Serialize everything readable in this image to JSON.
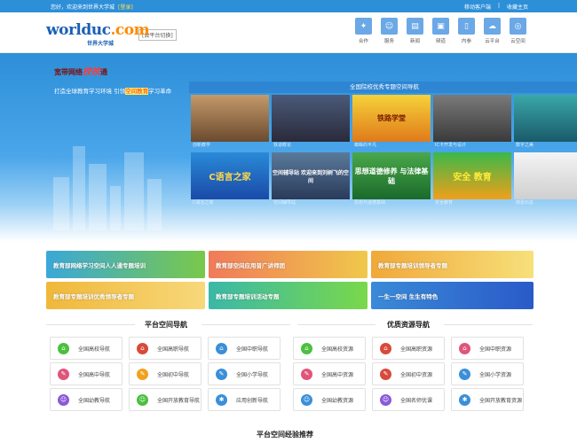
{
  "topbar": {
    "welcome": "您好，欢迎来到世界大学城",
    "login": "[登录]",
    "mobile": "移动客户端",
    "sep": "|",
    "favorite": "收藏主页"
  },
  "header": {
    "logo_text": "worlduc",
    "logo_accent": ".com",
    "logo_cn": "世界大学城",
    "switch_label": "[云平台切换]",
    "nav": [
      {
        "label": "合作",
        "icon": "handshake-icon"
      },
      {
        "label": "服务",
        "icon": "user-icon"
      },
      {
        "label": "新闻",
        "icon": "news-icon"
      },
      {
        "label": "频道",
        "icon": "channel-icon"
      },
      {
        "label": "内参",
        "icon": "document-icon"
      },
      {
        "label": "云平台",
        "icon": "cloud-icon"
      },
      {
        "label": "云空间",
        "icon": "space-icon"
      }
    ]
  },
  "banner": {
    "slogan_a": "宽带网络",
    "slogan_hl": "校校",
    "slogan_b": "通",
    "line_a": "打造全球教育学习环境  引领",
    "line_hl": "空间教育",
    "line_b": "学习革命"
  },
  "showcase": {
    "caption": "全国院校优秀专题空间导航",
    "tiles": [
      {
        "title": "创新教学",
        "text": ""
      },
      {
        "title": "铁道概论",
        "text": ""
      },
      {
        "title": "蜘蛛的平凡",
        "text": "铁路学堂"
      },
      {
        "title": "报刊的制作",
        "text": "一朵花的报刊制作"
      },
      {
        "title": "IC卡开发与设计",
        "text": ""
      },
      {
        "title": "数字之美",
        "text": ""
      },
      {
        "title": "C语言之家",
        "text": "C语言之家"
      },
      {
        "title": "空间辅导站",
        "text": "空间辅导站 欢迎来到刘树飞的空间"
      },
      {
        "title": "思想与道德基础",
        "text": "思想道德修养 与法律基础"
      },
      {
        "title": "安全教育",
        "text": "安全 教育"
      },
      {
        "title": "微景石友",
        "text": ""
      }
    ]
  },
  "promos": [
    {
      "label": "教育部网络学习空间人人通专题培训"
    },
    {
      "label": "教育部空间应用普广讲师团"
    },
    {
      "label": "教育部专题培训领导者专题"
    },
    {
      "label": "教育部专题培训优秀领导者专题"
    },
    {
      "label": "教育部专题培训活动专题"
    },
    {
      "label": "一生一空间 生生有特色"
    }
  ],
  "left_section": {
    "title": "平台空间导航",
    "items": [
      {
        "label": "全国高校导航",
        "color": "#4bbf3f",
        "icon": "A"
      },
      {
        "label": "全国高职导航",
        "color": "#d84a3a",
        "icon": "A"
      },
      {
        "label": "全国中职导航",
        "color": "#3a8fd8",
        "icon": "A"
      },
      {
        "label": "全国高中导航",
        "color": "#e0557a",
        "icon": "A"
      },
      {
        "label": "全国初中导航",
        "color": "#f0a21c",
        "icon": "A"
      },
      {
        "label": "全国小学导航",
        "color": "#3a8fd8",
        "icon": "A"
      },
      {
        "label": "全国幼教导航",
        "color": "#8a5ad8",
        "icon": "A"
      },
      {
        "label": "全国开放教育导航",
        "color": "#4bbf3f",
        "icon": "A"
      },
      {
        "label": "应用创新导航",
        "color": "#3a8fd8",
        "icon": "A"
      }
    ]
  },
  "right_section": {
    "title": "优质资源导航",
    "items": [
      {
        "label": "全国高校资源",
        "color": "#4bbf3f",
        "icon": "A"
      },
      {
        "label": "全国高职资源",
        "color": "#d84a3a",
        "icon": "A"
      },
      {
        "label": "全国中职资源",
        "color": "#e0557a",
        "icon": "A"
      },
      {
        "label": "全国高中资源",
        "color": "#e0557a",
        "icon": "A"
      },
      {
        "label": "全国初中资源",
        "color": "#d84a3a",
        "icon": "A"
      },
      {
        "label": "全国小学资源",
        "color": "#3a8fd8",
        "icon": "A"
      },
      {
        "label": "全国幼教资源",
        "color": "#3a8fd8",
        "icon": "A"
      },
      {
        "label": "全国名师优课",
        "color": "#8a5ad8",
        "icon": "A"
      },
      {
        "label": "全国开放教育资源",
        "color": "#3a8fd8",
        "icon": "A"
      }
    ]
  },
  "bottom": {
    "title": "平台空间经验推荐"
  }
}
